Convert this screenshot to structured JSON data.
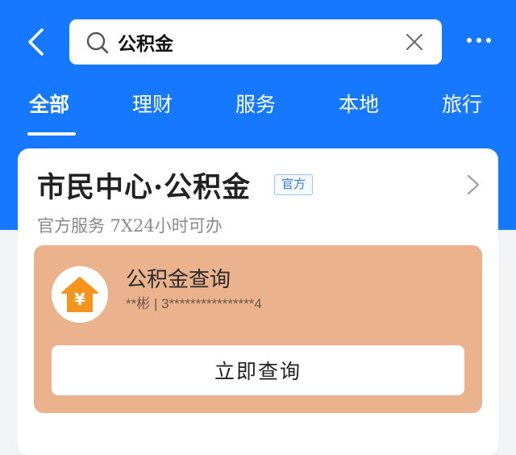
{
  "search": {
    "query": "公积金"
  },
  "tabs": [
    {
      "label": "全部",
      "active": true
    },
    {
      "label": "理财",
      "active": false
    },
    {
      "label": "服务",
      "active": false
    },
    {
      "label": "本地",
      "active": false
    },
    {
      "label": "旅行",
      "active": false
    }
  ],
  "card": {
    "title": "市民中心·公积金",
    "badge": "官方",
    "subtitle": "官方服务  7X24小时可办",
    "service": {
      "title": "公积金查询",
      "info": "**彬 | 3****************4",
      "icon_symbol": "¥",
      "button_label": "立即查询"
    }
  },
  "colors": {
    "primary_blue": "#1677ff",
    "panel_orange": "#eab38d",
    "house_icon_orange": "#f5941f"
  }
}
